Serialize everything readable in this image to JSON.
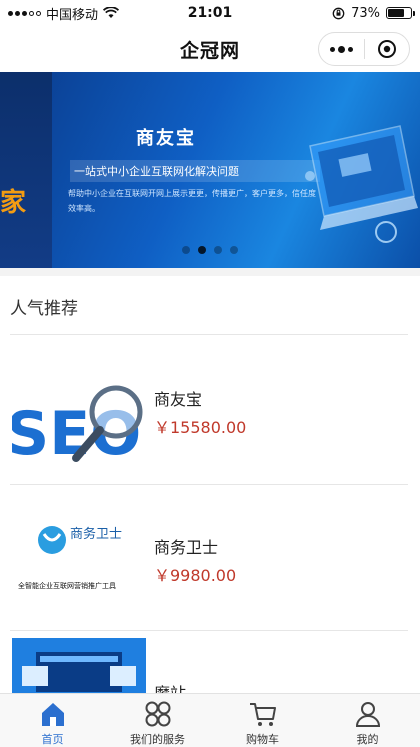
{
  "status_bar": {
    "carrier": "中国移动",
    "time": "21:01",
    "battery": "73%",
    "battery_level": 0.73
  },
  "nav": {
    "title": "企冠网"
  },
  "banner": {
    "title": "商友宝",
    "line1": "一站式中小企业互联网化解决问题",
    "line2": "帮助中小企业在互联网开网上展示更更，传播更广，客户更多，信任度效率高。",
    "left_fragment": "家",
    "slides": 4,
    "active_slide": 2
  },
  "section": {
    "title": "人气推荐"
  },
  "products": [
    {
      "name": "商友宝",
      "price": "￥15580.00",
      "image_text": "SEO"
    },
    {
      "name": "商务卫士",
      "price": "￥9980.00",
      "image_text": "全智能企业互联网营销推广工具",
      "logo_text": "商务卫士"
    },
    {
      "name": "魔站",
      "price": ""
    }
  ],
  "tabs": [
    {
      "label": "首页",
      "icon": "home-icon",
      "active": true
    },
    {
      "label": "我们的服务",
      "icon": "grid-icon",
      "active": false
    },
    {
      "label": "购物车",
      "icon": "cart-icon",
      "active": false
    },
    {
      "label": "我的",
      "icon": "user-icon",
      "active": false
    }
  ],
  "colors": {
    "accent": "#2b6fcf",
    "price": "#c0392b"
  }
}
